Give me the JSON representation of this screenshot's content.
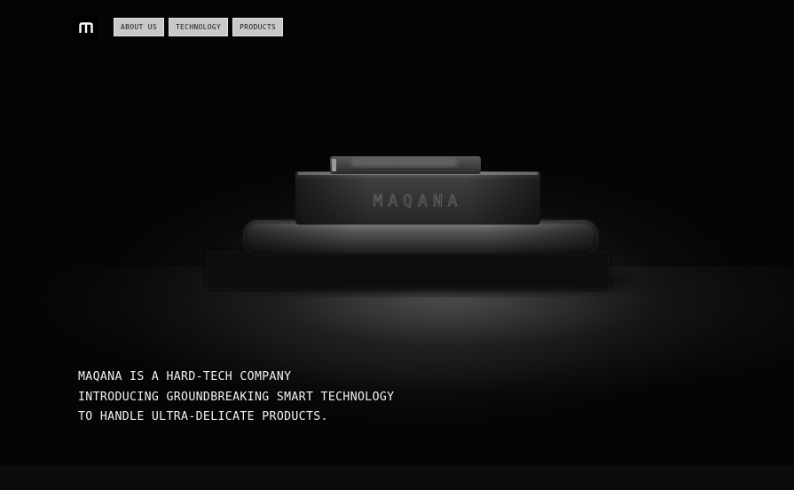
{
  "header": {
    "logo_icon": "maqana-m-logo-icon",
    "nav": [
      {
        "label": "ABOUT US"
      },
      {
        "label": "TECHNOLOGY"
      },
      {
        "label": "PRODUCTS"
      }
    ]
  },
  "hero": {
    "device_engraving": "MAQANA",
    "tagline": [
      "MAQANA IS A HARD-TECH COMPANY",
      "INTRODUCING GROUNDBREAKING SMART TECHNOLOGY",
      "TO HANDLE ULTRA-DELICATE PRODUCTS."
    ]
  },
  "colors": {
    "background": "#050505",
    "nav_button": "#c9c9c9",
    "text": "#f2f2f2"
  }
}
